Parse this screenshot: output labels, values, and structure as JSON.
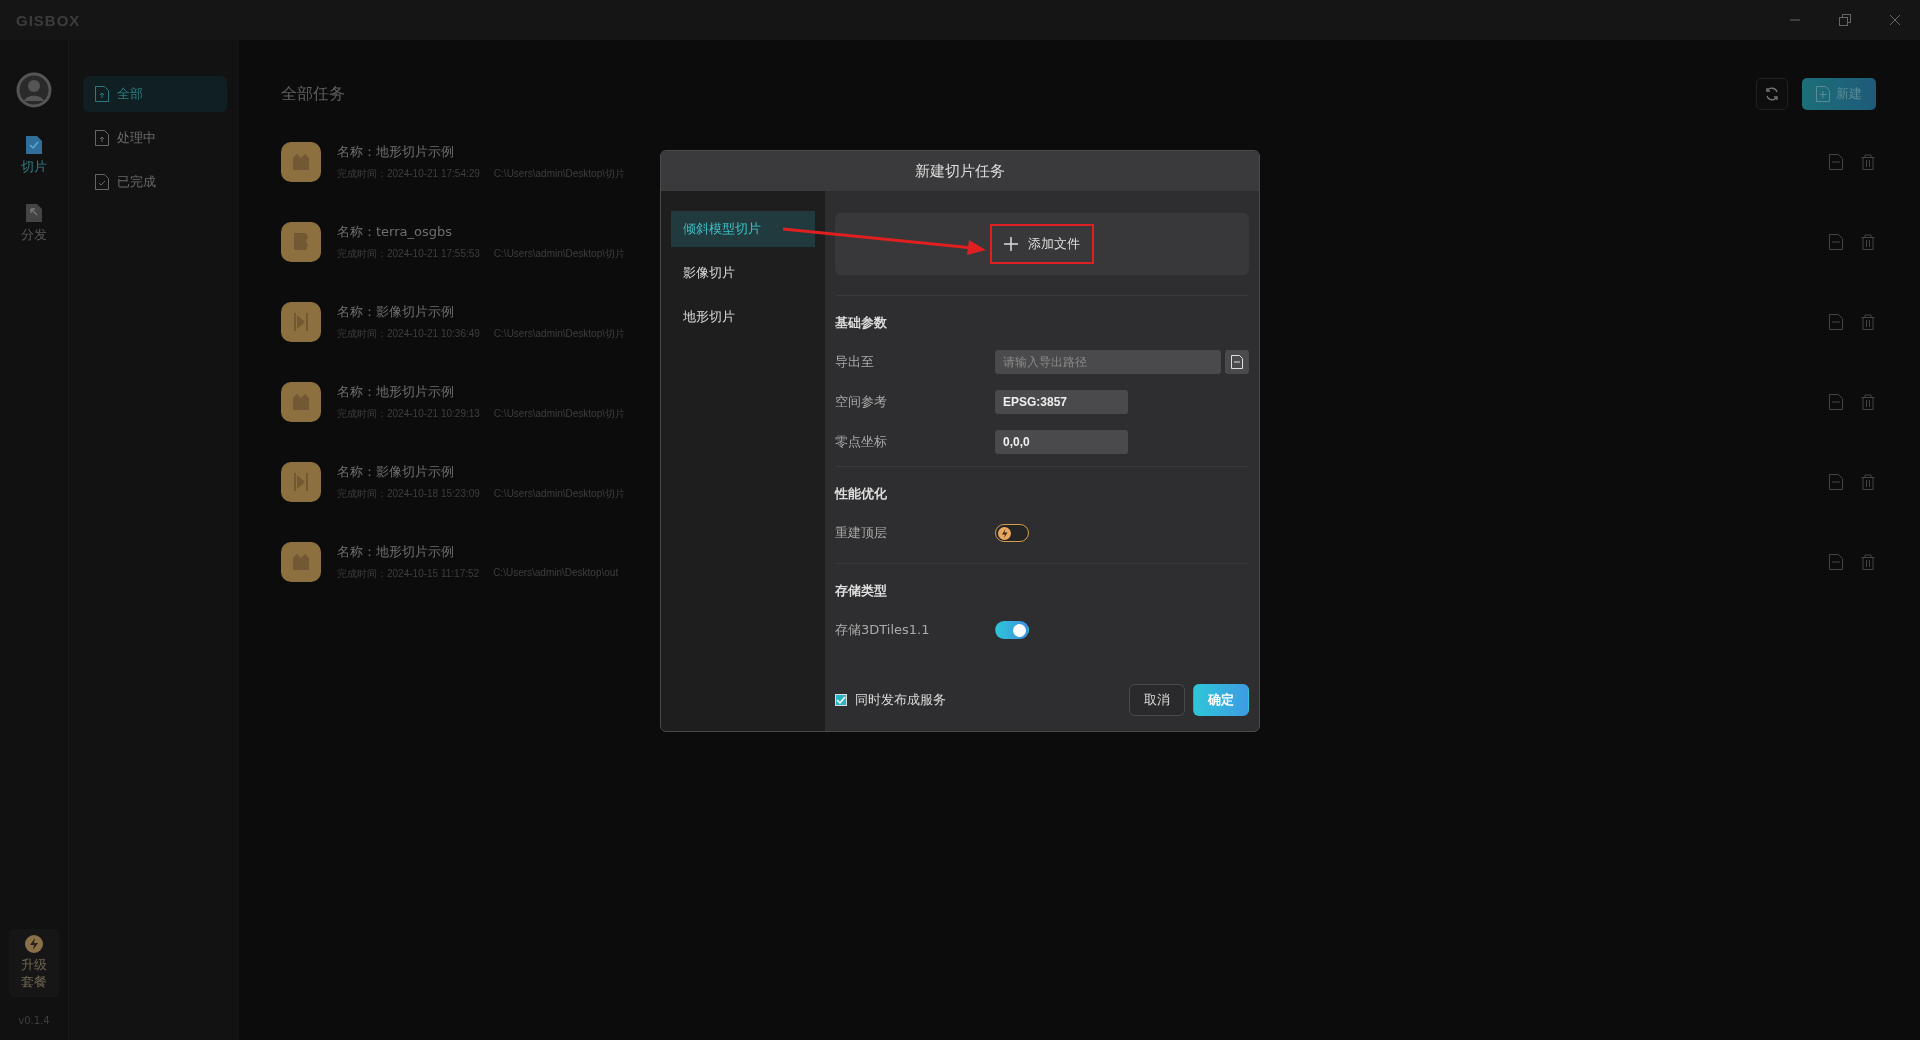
{
  "app": {
    "logo": "GISBOX",
    "version": "v0.1.4"
  },
  "rail": [
    {
      "label": "切片",
      "kind": "tiles",
      "selected": true
    },
    {
      "label": "分发",
      "kind": "publish",
      "selected": false
    }
  ],
  "upgrade": {
    "label": "升级套餐"
  },
  "filters": [
    {
      "label": "全部",
      "kind": "upload",
      "selected": true
    },
    {
      "label": "处理中",
      "kind": "upload",
      "selected": false
    },
    {
      "label": "已完成",
      "kind": "done",
      "selected": false
    }
  ],
  "main": {
    "title": "全部任务",
    "new_button": "新建"
  },
  "tasks": [
    {
      "kind": "terrain",
      "name": "名称：地形切片示例",
      "time": "完成时间：2024-10-21 17:54:29",
      "path": "C:\\Users\\admin\\Desktop\\切片"
    },
    {
      "kind": "model",
      "name": "名称：terra_osgbs",
      "time": "完成时间：2024-10-21 17:55:53",
      "path": "C:\\Users\\admin\\Desktop\\切片"
    },
    {
      "kind": "imagery",
      "name": "名称：影像切片示例",
      "time": "完成时间：2024-10-21 10:36:49",
      "path": "C:\\Users\\admin\\Desktop\\切片"
    },
    {
      "kind": "terrain",
      "name": "名称：地形切片示例",
      "time": "完成时间：2024-10-21 10:29:13",
      "path": "C:\\Users\\admin\\Desktop\\切片"
    },
    {
      "kind": "imagery",
      "name": "名称：影像切片示例",
      "time": "完成时间：2024-10-18 15:23:09",
      "path": "C:\\Users\\admin\\Desktop\\切片"
    },
    {
      "kind": "terrain",
      "name": "名称：地形切片示例",
      "time": "完成时间：2024-10-15 11:17:52",
      "path": "C:\\Users\\admin\\Desktop\\out"
    }
  ],
  "dialog": {
    "title": "新建切片任务",
    "types": [
      {
        "label": "倾斜模型切片",
        "selected": true
      },
      {
        "label": "影像切片",
        "selected": false
      },
      {
        "label": "地形切片",
        "selected": false
      }
    ],
    "add_file": "添加文件",
    "sections": [
      {
        "title": "基础参数",
        "fields": [
          {
            "kind": "path",
            "label": "导出至",
            "placeholder": "请输入导出路径"
          },
          {
            "kind": "text",
            "label": "空间参考",
            "value": "EPSG:3857"
          },
          {
            "kind": "text",
            "label": "零点坐标",
            "value": "0,0,0"
          }
        ]
      },
      {
        "title": "性能优化",
        "fields": [
          {
            "kind": "toggle",
            "label": "重建顶层",
            "on": false,
            "premium": true
          }
        ]
      },
      {
        "title": "存储类型",
        "fields": [
          {
            "kind": "toggle",
            "label": "存储3DTiles1.1",
            "on": true,
            "premium": false
          }
        ]
      }
    ],
    "publish": {
      "label": "同时发布成服务",
      "checked": true
    },
    "buttons": [
      {
        "label": "取消",
        "kind": "secondary"
      },
      {
        "label": "确定",
        "kind": "primary"
      }
    ]
  }
}
